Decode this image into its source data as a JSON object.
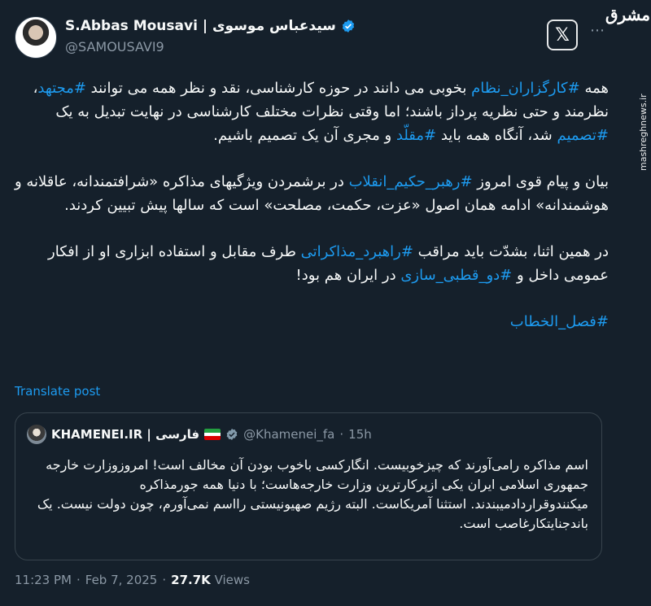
{
  "author": {
    "display_name": "S.Abbas Mousavi | سیدعباس موسوی",
    "handle": "@SAMOUSAVI9"
  },
  "watermark": {
    "logo_text": "مشرق",
    "url": "mashreghnews.ir"
  },
  "tweet": {
    "p1": {
      "t1": "همه ",
      "h1": "#کارگزاران_نظام",
      "t2": " بخوبی می دانند در حوزه کارشناسی، نقد و نظر همه می توانند ",
      "h2": "#مجتهد",
      "t3": "، نظرمند و حتی نظریه پرداز باشند؛ اما وقتی نظرات مختلف کارشناسی در نهایت تبدیل به یک ",
      "h3": "#تصمیم",
      "t4": " شد، آنگاه همه باید ",
      "h4": "#مقلّد",
      "t5": " و مجری آن یک تصمیم باشیم."
    },
    "p2": {
      "t1": "بیان و پیام قوی امروز ",
      "h1": "#رهبر_حکیم_انقلاب",
      "t2": " در برشمردن ویژگیهای مذاکره «شرافتمندانه، عاقلانه و هوشمندانه» ادامه همان اصول «عزت، حکمت، مصلحت» است که سالها پیش تبیین کردند."
    },
    "p3": {
      "t1": "در همین اثنا، بشدّت باید مراقب ",
      "h1": "#راهبرد_مذاکراتی",
      "t2": " طرف مقابل و استفاده ابزاری او از افکار عمومی داخل و ",
      "h2": "#دو_قطبی_سازی",
      "t3": " در ایران هم بود!"
    },
    "p4": {
      "h1": "#فصل_الخطاب"
    }
  },
  "translate_label": "Translate post",
  "quote": {
    "name": "KHAMENEI.IR | فارسی",
    "handle": "@Khamenei_fa",
    "dot": "·",
    "time": "15h",
    "text": "اسم مذاکره رامی‌آورند که چیزخوبیست. انگارکسی باخوب بودن آن مخالف است! امروزوزارت خارجه جمهوری اسلامی ایران یکی ازپرکارترین وزارت خارجه‌هاست؛ با دنیا همه جورمذاکره میکنندوقراردادمیبندند. استثنا آمریکاست. البته رژیم صهیونیستی رااسم نمی‌آورم، چون دولت نیست. یک باندجنایتکارغاصب است."
  },
  "meta": {
    "time": "11:23 PM",
    "sep": "·",
    "date": "Feb 7, 2025",
    "views_count": "27.7K",
    "views_label": "Views"
  },
  "colors": {
    "background": "#15202b",
    "link": "#1d9bf0",
    "secondary_text": "#8b98a5",
    "border": "#38444d"
  },
  "icons": {
    "verified": "verified-badge-icon",
    "x_logo": "x-logo-icon",
    "more": "more-dots-icon",
    "flag": "iran-flag-icon"
  }
}
